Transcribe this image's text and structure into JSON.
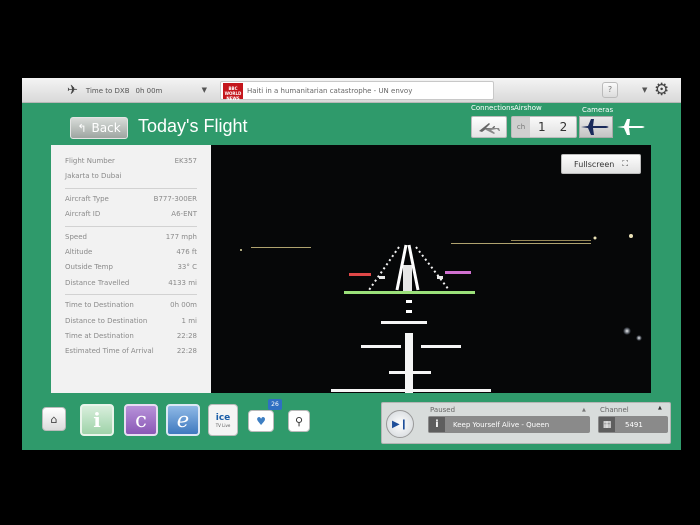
{
  "topbar": {
    "time_label": "Time to DXB",
    "time_value": "0h 00m",
    "news_ticker": "Haiti in a humanitarian catastrophe - UN envoy",
    "news_logo": "BBC WORLD NEWS",
    "help_label": "?"
  },
  "header": {
    "back_label": "Back",
    "title": "Today's Flight",
    "connections_label": "Connections",
    "airshow_label": "Airshow",
    "ch_label": "ch",
    "channels": [
      "1",
      "2"
    ],
    "cameras_label": "Cameras"
  },
  "flight_info": {
    "groups": [
      [
        {
          "label": "Flight Number",
          "value": "EK357"
        },
        {
          "label": "Jakarta to Dubai",
          "value": ""
        }
      ],
      [
        {
          "label": "Aircraft Type",
          "value": "B777-300ER"
        },
        {
          "label": "Aircraft ID",
          "value": "A6-ENT"
        }
      ],
      [
        {
          "label": "Speed",
          "value": "177 mph"
        },
        {
          "label": "Altitude",
          "value": "476 ft"
        },
        {
          "label": "Outside Temp",
          "value": "33° C"
        },
        {
          "label": "Distance Travelled",
          "value": "4133 mi"
        }
      ],
      [
        {
          "label": "Time to Destination",
          "value": "0h 00m"
        },
        {
          "label": "Distance to Destination",
          "value": "1 mi"
        },
        {
          "label": "Time at Destination",
          "value": "22:28"
        },
        {
          "label": "Estimated Time of Arrival",
          "value": "22:28"
        }
      ]
    ]
  },
  "video": {
    "fullscreen_label": "Fullscreen"
  },
  "dock": {
    "i_label": "i",
    "c_label": "c",
    "e_label": "e",
    "ice_label": "ice",
    "ice_sub": "TV Live",
    "fav_badge": "26",
    "icons": [
      "home-icon",
      "heart-icon",
      "search-icon"
    ]
  },
  "player": {
    "status": "Paused",
    "track": "Keep Yourself Alive - Queen",
    "channel_label": "Channel",
    "channel_number": "5491"
  },
  "colors": {
    "background_green": "#2f9a6b",
    "panel_gray": "#f2f2f2",
    "accent_blue": "#1f4f9a"
  }
}
